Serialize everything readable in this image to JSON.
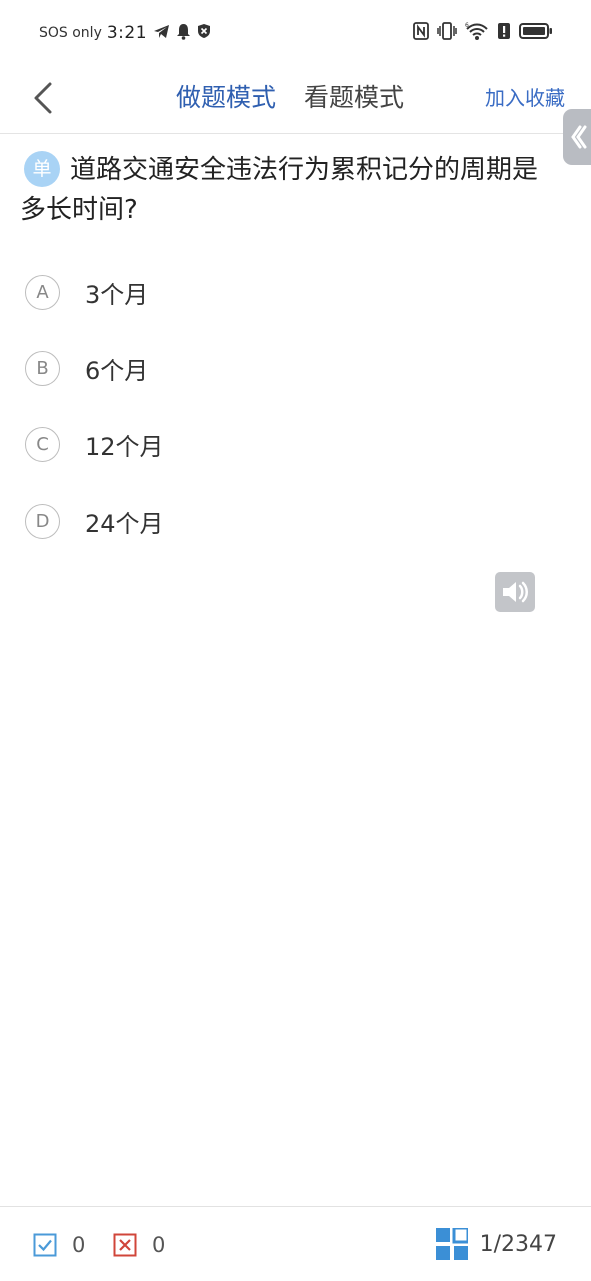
{
  "status_bar": {
    "carrier": "SOS only",
    "time": "3:21"
  },
  "header": {
    "mode_practice": "做题模式",
    "mode_view": "看题模式",
    "favorite": "加入收藏"
  },
  "question": {
    "type_badge": "单",
    "text": "道路交通安全违法行为累积记分的周期是多长时间?"
  },
  "options": [
    {
      "letter": "A",
      "text": "3个月"
    },
    {
      "letter": "B",
      "text": "6个月"
    },
    {
      "letter": "C",
      "text": "12个月"
    },
    {
      "letter": "D",
      "text": "24个月"
    }
  ],
  "footer": {
    "correct_count": "0",
    "wrong_count": "0",
    "progress": "1/2347"
  },
  "colors": {
    "accent": "#2f5fb0",
    "badge": "#a9d3f5",
    "correct": "#4a9ad8",
    "wrong": "#d0453a",
    "grid": "#3b8fd6"
  },
  "icons": [
    "telegram-icon",
    "bell-icon",
    "shield-icon",
    "nfc-icon",
    "vibrate-icon",
    "wifi-icon",
    "alert-icon",
    "battery-icon",
    "back-icon",
    "speaker-icon",
    "check-box-icon",
    "cross-box-icon",
    "answer-grid-icon"
  ]
}
